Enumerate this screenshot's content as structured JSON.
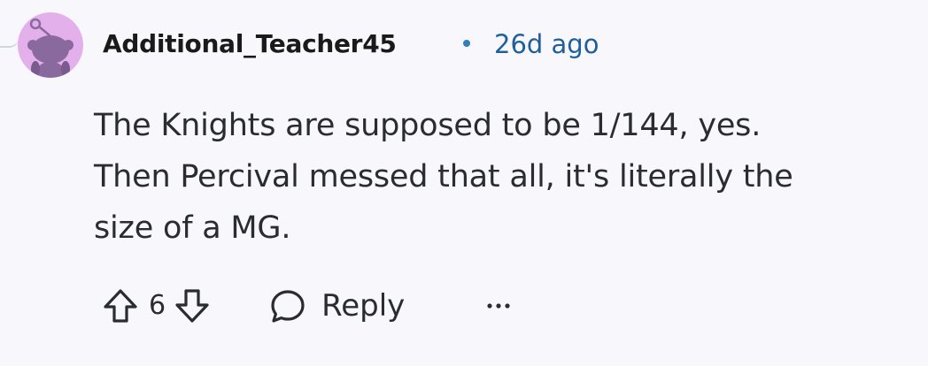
{
  "comment": {
    "author": "Additional_Teacher45",
    "separator": "•",
    "timestamp": "26d ago",
    "body_lines": [
      "The Knights are supposed to be 1/144, yes.",
      "Then Percival messed that all, it's literally the",
      "size of a MG."
    ],
    "score": "6",
    "reply_label": "Reply",
    "more_label": "..."
  },
  "icons": {
    "avatar": "snoo-avatar-icon",
    "upvote": "upvote-arrow-icon",
    "downvote": "downvote-arrow-icon",
    "reply": "speech-bubble-icon",
    "more": "ellipsis-icon"
  },
  "colors": {
    "background": "#f8f8fc",
    "avatar_bg": "#e3b0ec",
    "avatar_figure": "#8a6a9e",
    "username": "#1a1a1b",
    "timestamp": "#1f5f9c",
    "text": "#2a2c30"
  }
}
